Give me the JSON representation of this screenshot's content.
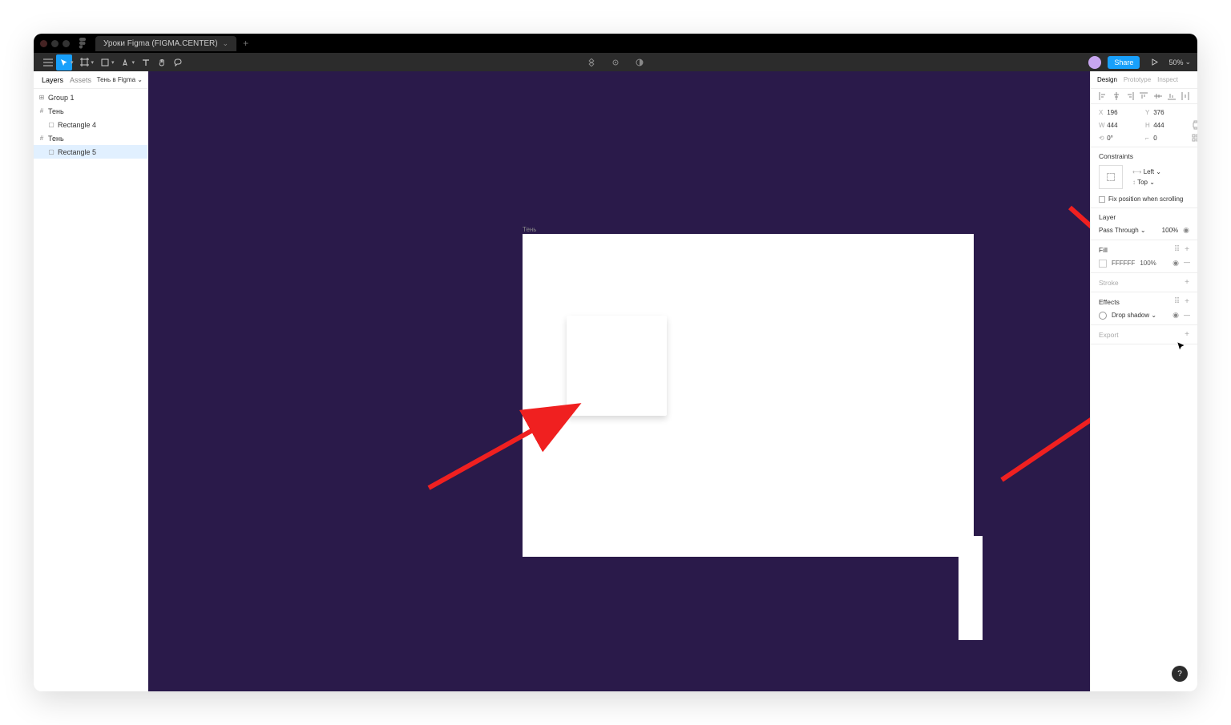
{
  "titlebar": {
    "tab_title": "Уроки Figma (FIGMA.CENTER)"
  },
  "toolbar": {
    "share": "Share",
    "zoom": "50%"
  },
  "left_panel": {
    "tab_layers": "Layers",
    "tab_assets": "Assets",
    "page": "Тень в Figma",
    "layers": {
      "group1": "Group 1",
      "frame_a": "Тень",
      "rect4": "Rectangle 4",
      "frame_b": "Тень",
      "rect5": "Rectangle 5"
    }
  },
  "canvas": {
    "frame_label": "Тень"
  },
  "right_panel": {
    "tab_design": "Design",
    "tab_prototype": "Prototype",
    "tab_inspect": "Inspect",
    "x": "196",
    "y": "376",
    "w": "444",
    "h": "444",
    "rot": "0°",
    "rad": "0",
    "constraints": {
      "title": "Constraints",
      "h": "Left",
      "v": "Top",
      "fix": "Fix position when scrolling"
    },
    "layer": {
      "title": "Layer",
      "blend": "Pass Through",
      "opacity": "100%"
    },
    "fill": {
      "title": "Fill",
      "hex": "FFFFFF",
      "pct": "100%"
    },
    "stroke": {
      "title": "Stroke"
    },
    "effects": {
      "title": "Effects",
      "item": "Drop shadow"
    },
    "export": {
      "title": "Export"
    }
  },
  "help": "?"
}
